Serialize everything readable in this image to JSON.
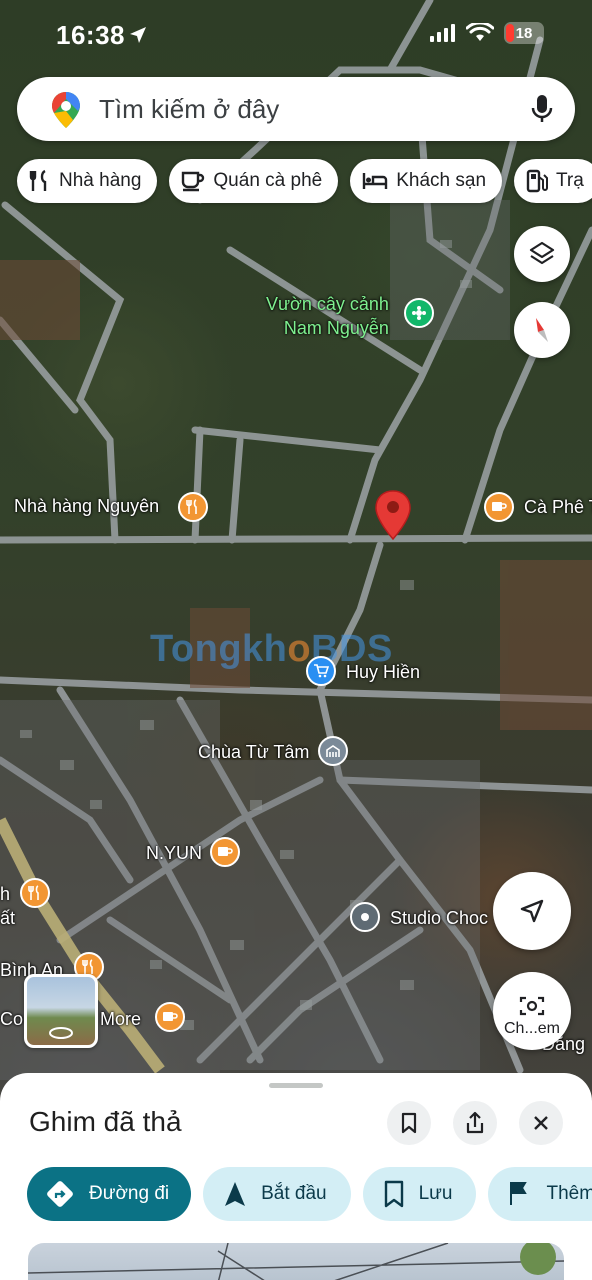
{
  "status_bar": {
    "time": "16:38",
    "battery": "18"
  },
  "search": {
    "placeholder": "Tìm kiếm ở đây"
  },
  "chips": [
    {
      "label": "Nhà hàng",
      "icon": "restaurant-icon"
    },
    {
      "label": "Quán cà phê",
      "icon": "coffee-icon"
    },
    {
      "label": "Khách sạn",
      "icon": "hotel-icon"
    },
    {
      "label": "Trạ",
      "icon": "gas-station-icon"
    }
  ],
  "map_labels": {
    "nursery": "Vườn cây cảnh\nNam Nguyễn",
    "restaurant_nguyen": "Nhà hàng Nguyên",
    "cafe_right": "Cà Phê T",
    "watermark_a": "Tongkh",
    "watermark_b": "BDS",
    "huy_hien": "Huy Hiền",
    "chua_tu_tam": "Chùa Từ Tâm",
    "nyun": "N.YUN",
    "studio": "Studio Choc",
    "binh_an": "Bình An",
    "more": "More",
    "left_h": "h",
    "left_at": "ất",
    "left_c": "Co",
    "bottom_right": "Đắng",
    "photo_button": "Ch...em"
  },
  "sheet": {
    "title": "Ghim đã thả",
    "actions": [
      {
        "label": "Đường đi",
        "icon": "directions-icon"
      },
      {
        "label": "Bắt đầu",
        "icon": "navigation-icon"
      },
      {
        "label": "Lưu",
        "icon": "bookmark-icon"
      },
      {
        "label": "Thêm",
        "icon": "flag-icon"
      }
    ]
  },
  "colors": {
    "pin": "#e53935",
    "primary_action": "#0b7285",
    "action_bg": "#d3eef5",
    "poi_orange": "#f29633"
  }
}
